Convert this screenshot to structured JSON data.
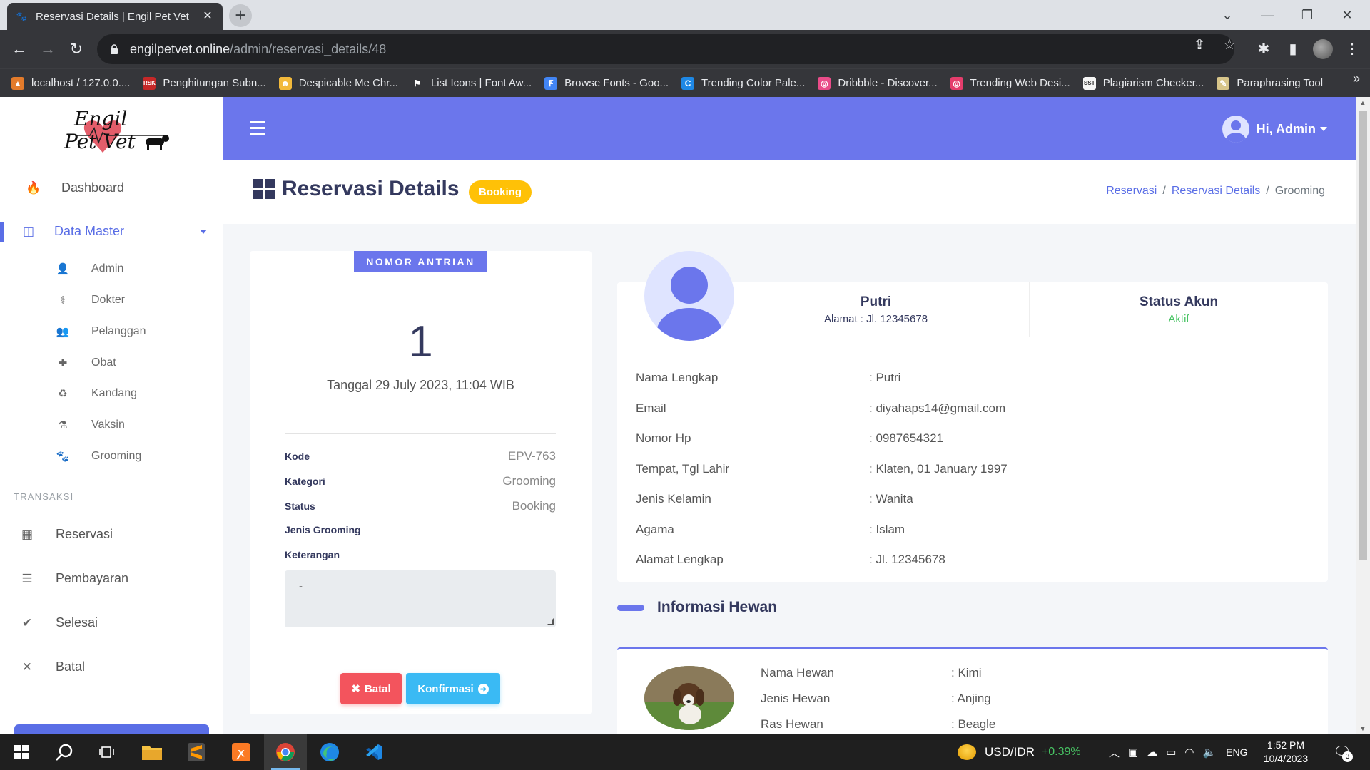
{
  "browser": {
    "tab_title": "Reservasi Details | Engil Pet Vet",
    "url_host": "engilpetvet.online",
    "url_path": "/admin/reservasi_details/48",
    "bookmarks": [
      {
        "label": "localhost / 127.0.0....",
        "color": "#e37b2b",
        "glyph": "▲"
      },
      {
        "label": "Penghitungan Subn...",
        "color": "#c62828",
        "glyph": "RSK"
      },
      {
        "label": "Despicable Me Chr...",
        "color": "#f2b93b",
        "glyph": "☻"
      },
      {
        "label": "List Icons | Font Aw...",
        "color": "#35363a",
        "glyph": "⚑"
      },
      {
        "label": "Browse Fonts - Goo...",
        "color": "#4285f4",
        "glyph": "Ꞙ"
      },
      {
        "label": "Trending Color Pale...",
        "color": "#1e88e5",
        "glyph": "C"
      },
      {
        "label": "Dribbble - Discover...",
        "color": "#ea4c89",
        "glyph": "◎"
      },
      {
        "label": "Trending Web Desi...",
        "color": "#e53d6c",
        "glyph": "◎"
      },
      {
        "label": "Plagiarism Checker...",
        "color": "#f5f5f5",
        "glyph": "SST"
      },
      {
        "label": "Paraphrasing Tool",
        "color": "#d7c58a",
        "glyph": "✎"
      }
    ]
  },
  "sidebar": {
    "logo_line1": "Engil",
    "logo_line2": "Pet Vet",
    "dashboard": "Dashboard",
    "data_master": "Data Master",
    "sub_items": [
      "Admin",
      "Dokter",
      "Pelanggan",
      "Obat",
      "Kandang",
      "Vaksin",
      "Grooming"
    ],
    "section_transaksi": "TRANSAKSI",
    "transaksi_items": [
      "Reservasi",
      "Pembayaran",
      "Selesai",
      "Batal"
    ]
  },
  "topnav": {
    "greeting": "Hi, Admin"
  },
  "header": {
    "title": "Reservasi Details",
    "status_badge": "Booking",
    "breadcrumb": [
      "Reservasi",
      "Reservasi Details",
      "Grooming"
    ]
  },
  "queue": {
    "label": "NOMOR ANTRIAN",
    "number": "1",
    "date": "Tanggal 29 July 2023, 11:04 WIB",
    "fields": [
      {
        "key": "Kode",
        "value": "EPV-763"
      },
      {
        "key": "Kategori",
        "value": "Grooming"
      },
      {
        "key": "Status",
        "value": "Booking"
      },
      {
        "key": "Jenis Grooming",
        "value": ""
      },
      {
        "key": "Keterangan",
        "value": ""
      }
    ],
    "keterangan_value": "-",
    "btn_batal": "Batal",
    "btn_konfirmasi": "Konfirmasi"
  },
  "profile": {
    "name": "Putri",
    "address": "Alamat : Jl. 12345678",
    "status_title": "Status Akun",
    "status_value": "Aktif",
    "details": [
      {
        "label": "Nama Lengkap",
        "value": ": Putri"
      },
      {
        "label": "Email",
        "value": ": diyahaps14@gmail.com"
      },
      {
        "label": "Nomor Hp",
        "value": ": 0987654321"
      },
      {
        "label": "Tempat, Tgl Lahir",
        "value": ": Klaten, 01 January 1997"
      },
      {
        "label": "Jenis Kelamin",
        "value": ": Wanita"
      },
      {
        "label": "Agama",
        "value": ": Islam"
      },
      {
        "label": "Alamat Lengkap",
        "value": ": Jl. 12345678"
      }
    ]
  },
  "pet_section": {
    "title": "Informasi Hewan",
    "details": [
      {
        "label": "Nama Hewan",
        "value": ": Kimi"
      },
      {
        "label": "Jenis Hewan",
        "value": ": Anjing"
      },
      {
        "label": "Ras Hewan",
        "value": ": Beagle"
      }
    ]
  },
  "taskbar": {
    "ticker": "USD/IDR",
    "ticker_change": "+0.39%",
    "lang": "ENG",
    "time": "1:52 PM",
    "date": "10/4/2023",
    "notification_count": "3"
  },
  "colors": {
    "primary": "#6b76ec",
    "warning": "#ffc107",
    "danger": "#f3545d",
    "info": "#3abaf4",
    "success": "#47c363"
  }
}
